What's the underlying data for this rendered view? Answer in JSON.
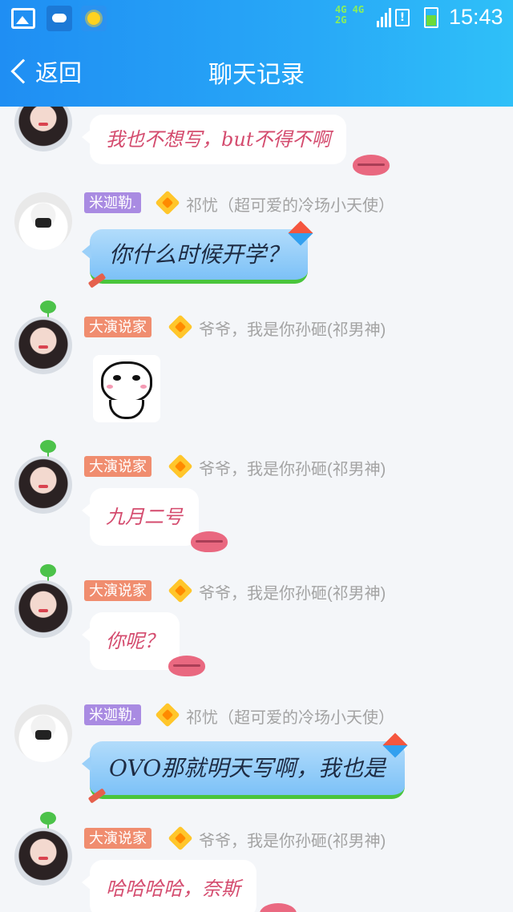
{
  "status_bar": {
    "network": "4G 4G 2G",
    "alert": "!",
    "time": "15:43"
  },
  "header": {
    "back_label": "返回",
    "title": "聊天记录"
  },
  "messages": [
    {
      "sender_title": "",
      "sender_name": "",
      "text": "我也不想写，but不得不啊"
    },
    {
      "sender_title": "米迦勒.",
      "sender_name": "祁忧（超可爱的冷场小天使）",
      "text": "你什么时候开学？"
    },
    {
      "sender_title": "大演说家",
      "sender_name": "爷爷，我是你孙砸(祁男神)",
      "text": ""
    },
    {
      "sender_title": "大演说家",
      "sender_name": "爷爷，我是你孙砸(祁男神)",
      "text": "九月二号"
    },
    {
      "sender_title": "大演说家",
      "sender_name": "爷爷，我是你孙砸(祁男神)",
      "text": "你呢？"
    },
    {
      "sender_title": "米迦勒.",
      "sender_name": "祁忧（超可爱的冷场小天使）",
      "text": "OVO那就明天写啊，我也是"
    },
    {
      "sender_title": "大演说家",
      "sender_name": "爷爷，我是你孙砸(祁男神)",
      "text": "哈哈哈哈，奈斯"
    }
  ],
  "colors": {
    "header_start": "#1f8ef3",
    "header_end": "#2fc0f8",
    "title_purple": "#a98be2",
    "title_orange": "#f08d6f",
    "pink_text": "#d44b6e"
  }
}
